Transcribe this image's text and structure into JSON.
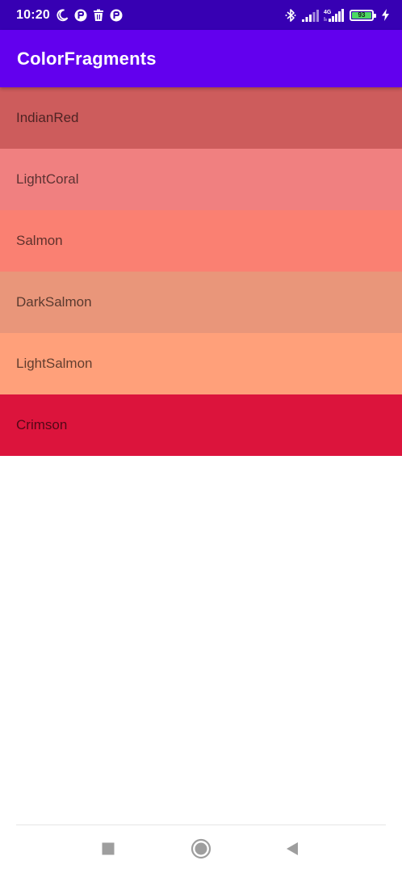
{
  "status_bar": {
    "time": "10:20",
    "left_icons": [
      "moon-icon",
      "notification-icon",
      "trash-icon",
      "notification-icon"
    ],
    "right_icons": [
      "bluetooth-icon",
      "signal-icon",
      "signal-4g-icon"
    ],
    "network_type": "4G",
    "battery_level": "93",
    "charging": true
  },
  "app_bar": {
    "title": "ColorFragments",
    "color": "#6200EE"
  },
  "colors": [
    {
      "name": "IndianRed",
      "hex": "#CD5C5C"
    },
    {
      "name": "LightCoral",
      "hex": "#F08080"
    },
    {
      "name": "Salmon",
      "hex": "#FA8072"
    },
    {
      "name": "DarkSalmon",
      "hex": "#E9967A"
    },
    {
      "name": "LightSalmon",
      "hex": "#FFA07A"
    },
    {
      "name": "Crimson",
      "hex": "#DC143C"
    }
  ],
  "nav_bar": {
    "buttons": [
      "recents-button",
      "home-button",
      "back-button"
    ]
  }
}
